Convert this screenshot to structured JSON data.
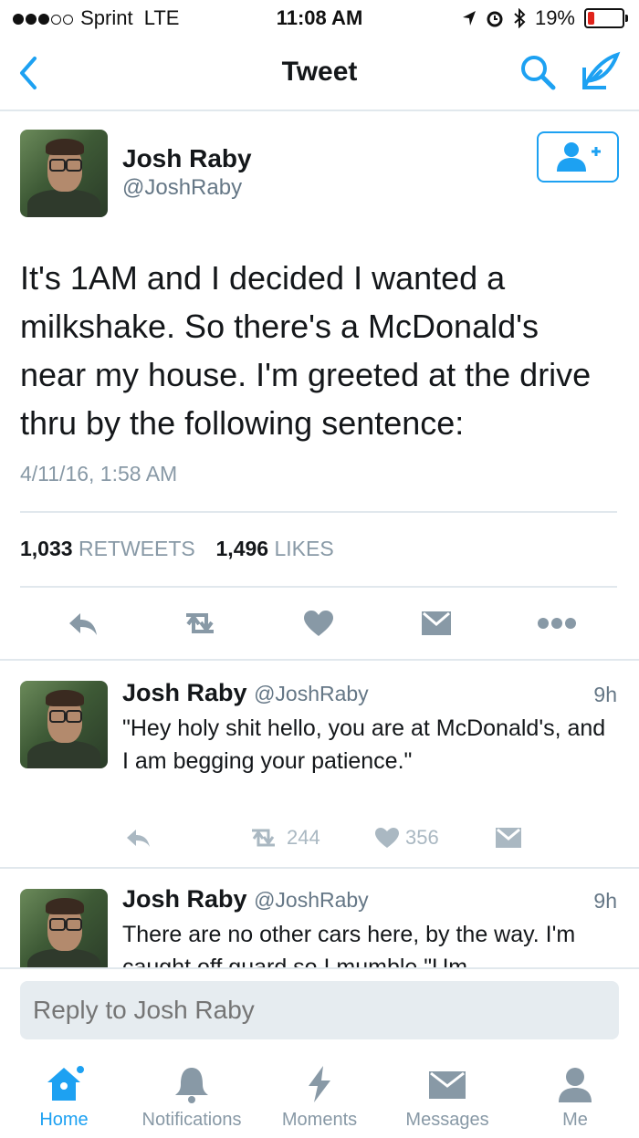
{
  "status_bar": {
    "carrier": "Sprint",
    "network": "LTE",
    "time": "11:08 AM",
    "battery": "19%",
    "battery_level": 0.19,
    "signal_bars": 3,
    "signal_total": 5
  },
  "nav": {
    "title": "Tweet"
  },
  "tweet": {
    "author_name": "Josh Raby",
    "author_handle": "@JoshRaby",
    "text": "It's 1AM and I decided I wanted a milkshake. So there's a McDonald's near my house. I'm greeted at the drive thru by the following sentence:",
    "timestamp": "4/11/16, 1:58 AM",
    "retweets_count": "1,033",
    "retweets_label": "RETWEETS",
    "likes_count": "1,496",
    "likes_label": "LIKES"
  },
  "replies": [
    {
      "name": "Josh Raby",
      "handle": "@JoshRaby",
      "time": "9h",
      "text": "\"Hey holy shit hello, you are at McDonald's, and I am begging your patience.\"",
      "retweets": "244",
      "likes": "356"
    },
    {
      "name": "Josh Raby",
      "handle": "@JoshRaby",
      "time": "9h",
      "text": "There are no other cars here, by the way. I'm caught off guard so I mumble \"Um"
    }
  ],
  "reply_input": {
    "placeholder": "Reply to Josh Raby"
  },
  "tabs": [
    {
      "label": "Home"
    },
    {
      "label": "Notifications"
    },
    {
      "label": "Moments"
    },
    {
      "label": "Messages"
    },
    {
      "label": "Me"
    }
  ],
  "colors": {
    "accent": "#1da1f2",
    "icon_gray": "#8899a6",
    "battery_low": "#e0231b"
  }
}
